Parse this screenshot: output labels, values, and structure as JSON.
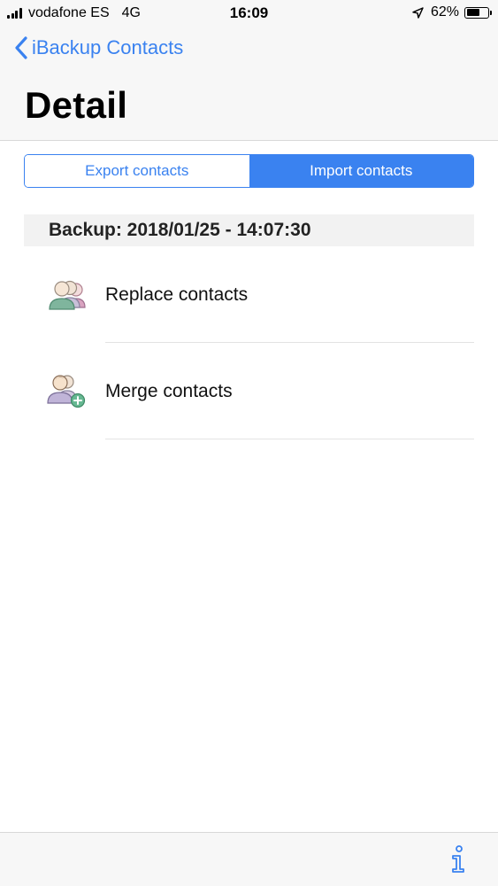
{
  "status_bar": {
    "carrier": "vodafone ES",
    "network": "4G",
    "time": "16:09",
    "battery_percent": "62%",
    "battery_level": 0.62,
    "signal_bars": 4
  },
  "nav": {
    "back_label": "iBackup Contacts",
    "title": "Detail"
  },
  "segments": {
    "export_label": "Export contacts",
    "import_label": "Import contacts",
    "selected": "import"
  },
  "backup": {
    "label": "Backup: 2018/01/25 - 14:07:30"
  },
  "actions": [
    {
      "label": "Replace contacts",
      "icon": "users-group-icon"
    },
    {
      "label": "Merge contacts",
      "icon": "user-add-icon"
    }
  ],
  "colors": {
    "accent": "#3a82f0",
    "header_bg": "#f2f2f2",
    "bar_bg": "#f7f7f7"
  },
  "toolbar": {
    "info_icon": "info-icon"
  }
}
